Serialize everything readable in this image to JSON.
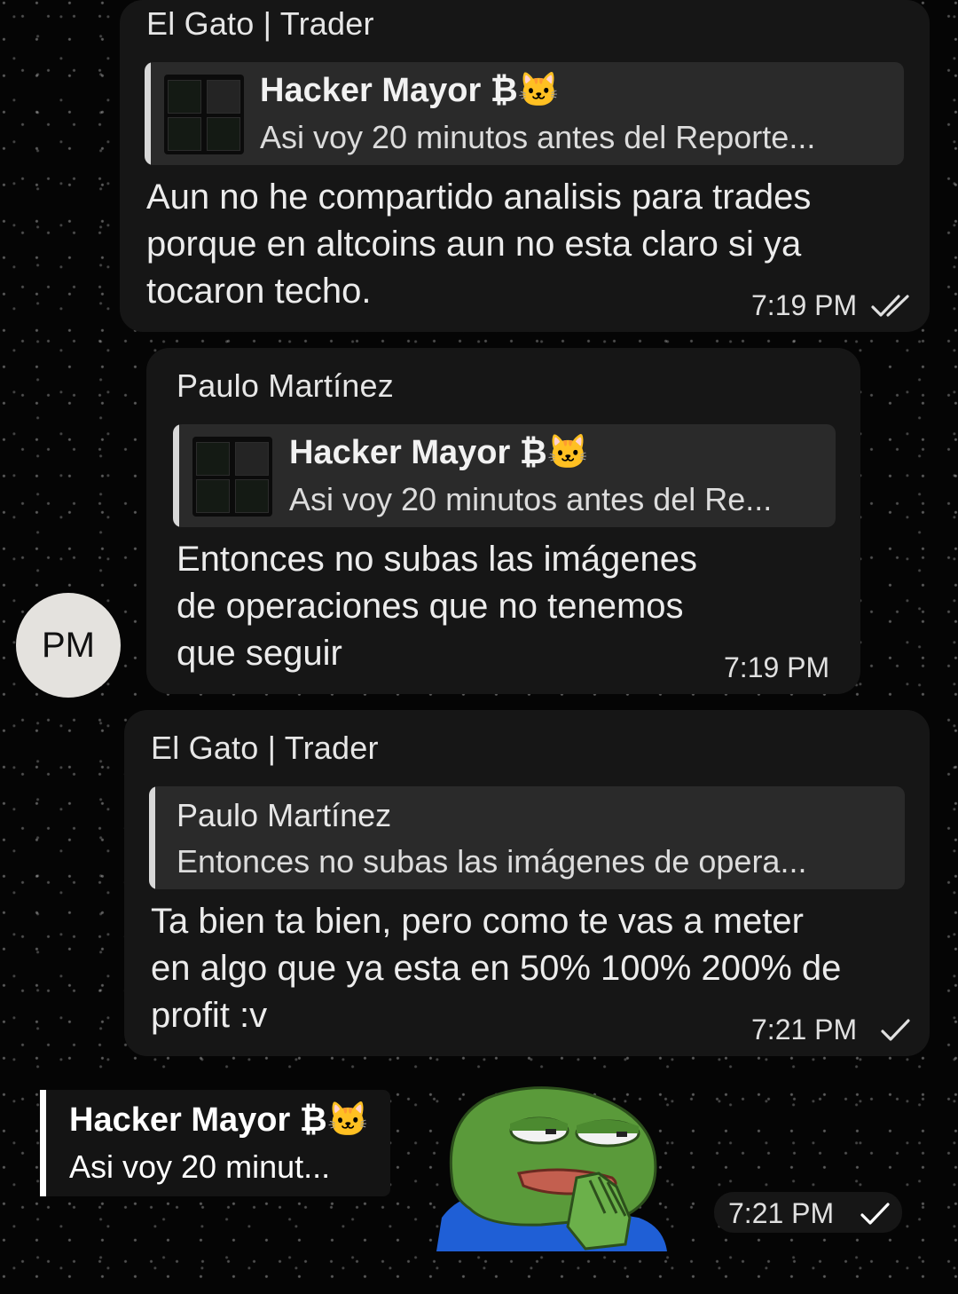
{
  "messages": [
    {
      "sender": "El Gato | Trader",
      "reply_to": {
        "name": "Hacker Mayor ₿🐱",
        "text": "Asi voy 20 minutos antes del Reporte..."
      },
      "text": "Aun no he compartido analisis para trades\nporque en altcoins aun no esta claro si ya\ntocaron techo.",
      "time": "7:19 PM",
      "status": "read"
    },
    {
      "sender": "Paulo Martínez",
      "avatar_initials": "PM",
      "reply_to": {
        "name": "Hacker Mayor ₿🐱",
        "text": "Asi voy 20 minutos antes del Re..."
      },
      "text": "Entonces no subas las imágenes\nde operaciones que no tenemos\nque seguir",
      "time": "7:19 PM"
    },
    {
      "sender": "El Gato | Trader",
      "reply_to": {
        "name": "Paulo Martínez",
        "text": "Entonces no subas las imágenes de opera..."
      },
      "text": "Ta bien ta bien, pero como te vas a meter\nen algo que ya esta en 50% 100% 200% de\nprofit :v",
      "time": "7:21 PM",
      "status": "sent"
    },
    {
      "reply_to": {
        "name": "Hacker Mayor ₿🐱",
        "text": "Asi voy 20 minut..."
      },
      "sticker": "pepe-frog-sticker",
      "time": "7:21 PM",
      "status": "sent"
    }
  ],
  "icons": {
    "double_check": "double-check-icon",
    "single_check": "check-icon"
  },
  "colors": {
    "bubble": "#161616",
    "reply_block": "#2a2a2a",
    "sticker_green": "#5a9a3a",
    "sticker_blue": "#1f5fd6"
  }
}
